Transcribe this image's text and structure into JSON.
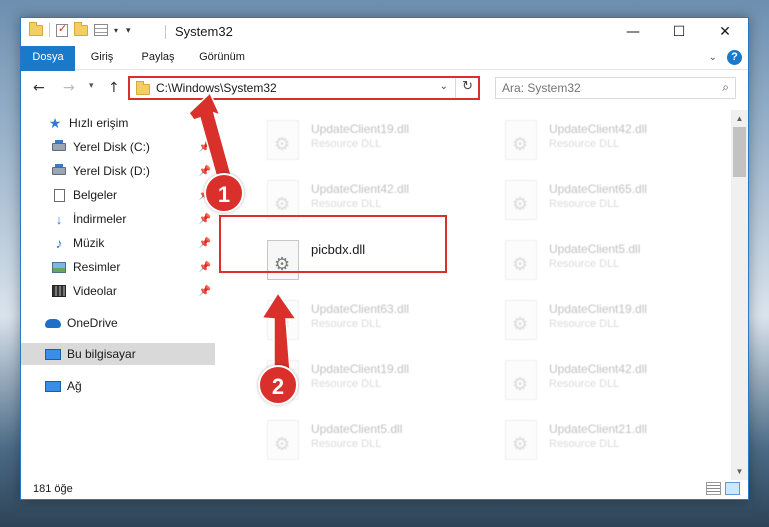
{
  "window": {
    "title": "System32",
    "controls": {
      "minimize": "—",
      "maximize": "☐",
      "close": "✕"
    }
  },
  "ribbon": {
    "tabs": [
      {
        "label": "Dosya",
        "active": true
      },
      {
        "label": "Giriş"
      },
      {
        "label": "Paylaş"
      },
      {
        "label": "Görünüm"
      }
    ],
    "help": "?"
  },
  "address": {
    "path": "C:\\Windows\\System32",
    "search_placeholder": "Ara: System32"
  },
  "nav": {
    "items": [
      {
        "label": "Hızlı erişim",
        "icon": "star-icon"
      },
      {
        "label": "Yerel Disk (C:)",
        "icon": "drive-icon",
        "pinned": true
      },
      {
        "label": "Yerel Disk (D:)",
        "icon": "drive-icon",
        "pinned": true
      },
      {
        "label": "Belgeler",
        "icon": "document-icon",
        "pinned": true
      },
      {
        "label": "İndirmeler",
        "icon": "download-icon",
        "pinned": true
      },
      {
        "label": "Müzik",
        "icon": "music-icon",
        "pinned": true
      },
      {
        "label": "Resimler",
        "icon": "pictures-icon",
        "pinned": true
      },
      {
        "label": "Videolar",
        "icon": "videos-icon",
        "pinned": true
      },
      {
        "label": "OneDrive",
        "icon": "cloud-icon"
      },
      {
        "label": "Bu bilgisayar",
        "icon": "computer-icon",
        "selected": true
      },
      {
        "label": "Ağ",
        "icon": "network-icon"
      }
    ]
  },
  "files": [
    {
      "name": "UpdateClient19.dll",
      "type": "Resource DLL"
    },
    {
      "name": "UpdateClient42.dll",
      "type": "Resource DLL"
    },
    {
      "name": "UpdateClient42.dll",
      "type": "Resource DLL"
    },
    {
      "name": "UpdateClient65.dll",
      "type": "Resource DLL"
    },
    {
      "name": "picbdx.dll",
      "type": ""
    },
    {
      "name": "UpdateClient5.dll",
      "type": "Resource DLL"
    },
    {
      "name": "UpdateClient63.dll",
      "type": "Resource DLL"
    },
    {
      "name": "UpdateClient19.dll",
      "type": "Resource DLL"
    },
    {
      "name": "UpdateClient19.dll",
      "type": "Resource DLL"
    },
    {
      "name": "UpdateClient42.dll",
      "type": "Resource DLL"
    },
    {
      "name": "UpdateClient5.dll",
      "type": "Resource DLL"
    },
    {
      "name": "UpdateClient21.dll",
      "type": "Resource DLL"
    }
  ],
  "status": {
    "count": "181 öğe"
  },
  "annotations": {
    "step1": "1",
    "step2": "2",
    "color": "#d9302c"
  }
}
